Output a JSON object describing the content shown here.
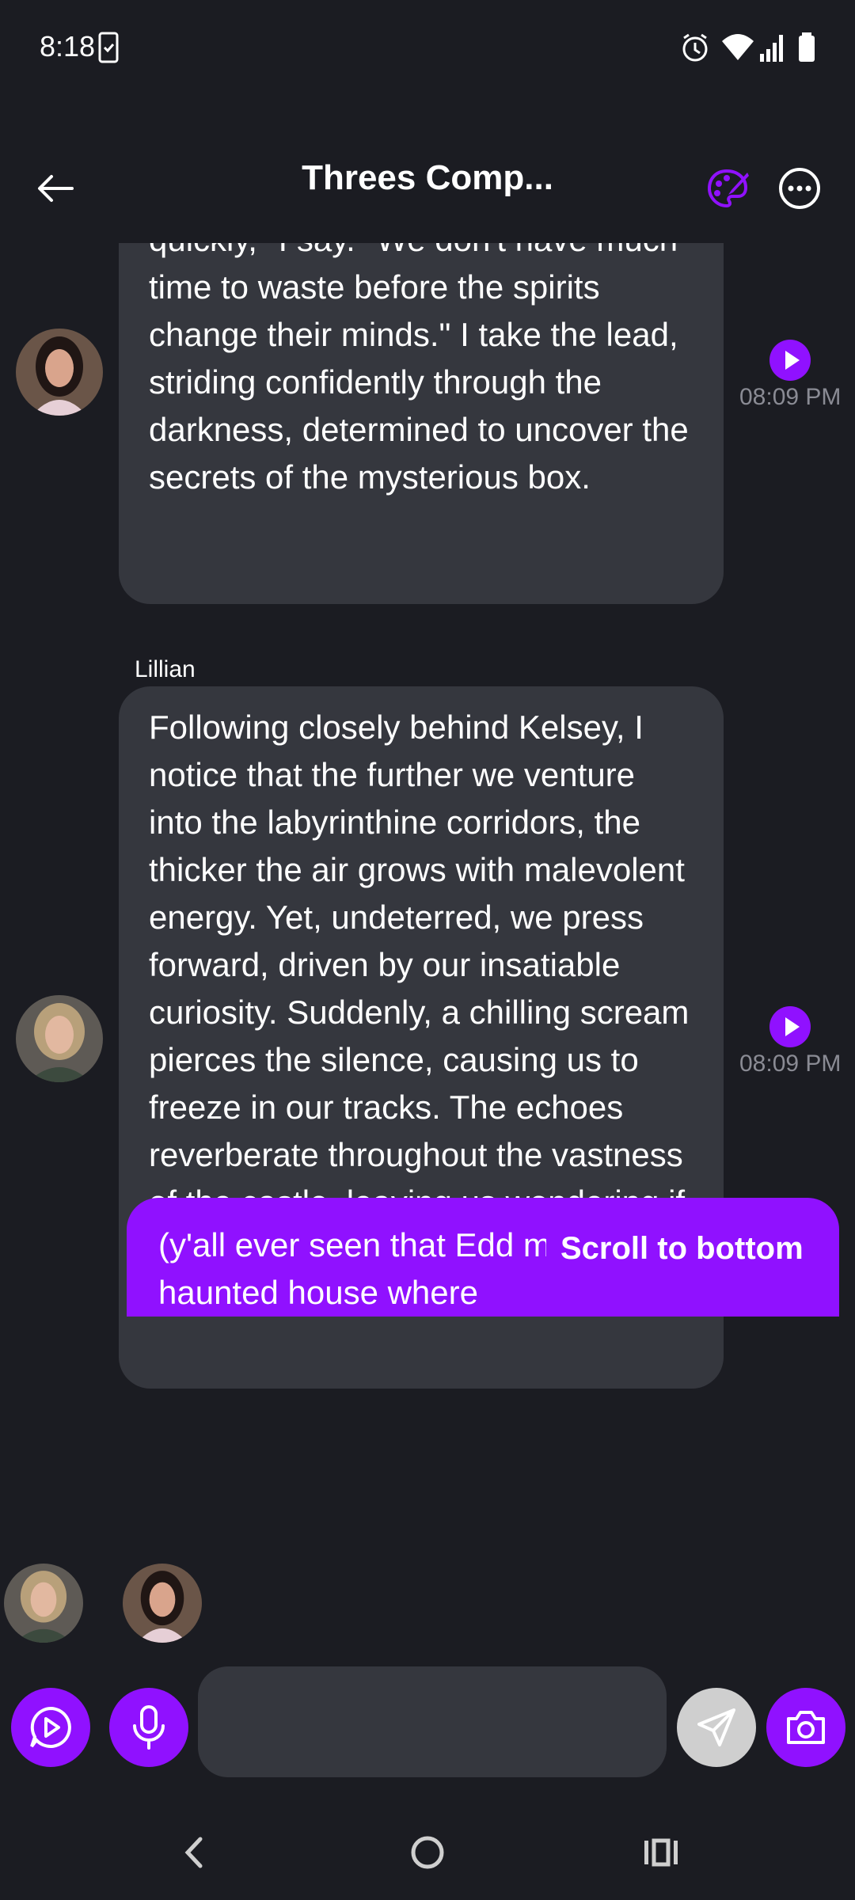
{
  "status_bar": {
    "time": "8:18"
  },
  "header": {
    "title": "Threes Comp..."
  },
  "messages": [
    {
      "sender": "",
      "text": "quickly,\" I say. \"We don't have much time to waste before the spirits change their minds.\" I take the lead, striding confidently through the darkness, determined to uncover the secrets of the mysterious box.",
      "time": "08:09 PM"
    },
    {
      "sender": "Lillian",
      "text": "Following closely behind Kelsey, I notice that the further we venture into the labyrinthine corridors, the thicker the air grows with malevolent energy. Yet, undeterred, we press forward, driven by our insatiable curiosity. Suddenly, a chilling scream pierces the silence, causing us to freeze in our tracks. The echoes reverberate throughout the vastness of the castle, leaving us wondering if we are truly alone.",
      "time": "08:09 PM"
    }
  ],
  "user_message": {
    "text": "(y'all ever seen that Edd movie with the haunted house where"
  },
  "scroll_to_bottom": {
    "label": "Scroll to bottom"
  },
  "composer": {
    "placeholder": "",
    "value": ""
  },
  "colors": {
    "accent": "#9011ff",
    "bubble": "#35373e",
    "background": "#1b1c22"
  }
}
